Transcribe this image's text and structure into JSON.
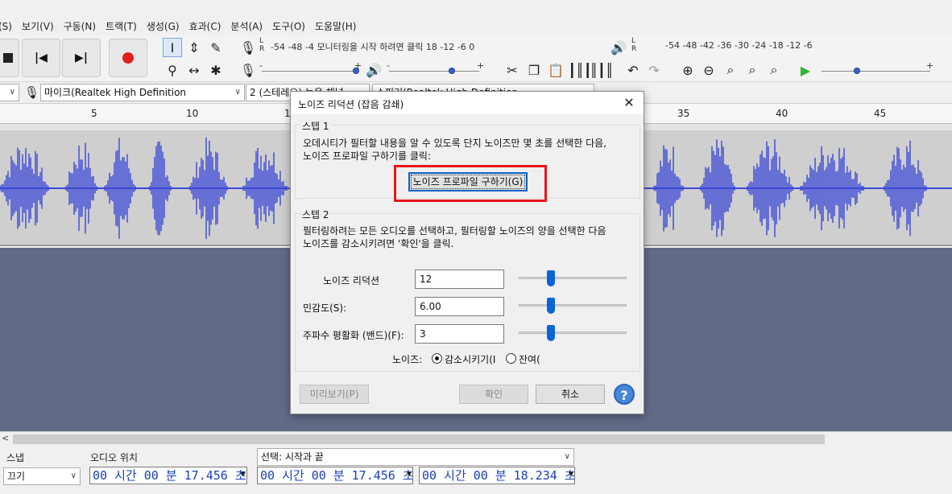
{
  "menu": [
    "(S)",
    "보기(V)",
    "구동(N)",
    "트랙(T)",
    "생성(G)",
    "효과(C)",
    "분석(A)",
    "도구(O)",
    "도움말(H)"
  ],
  "toolbar": {
    "rec_meter_text": "-54   -48   -4 모니터링을 시작 하려면 클릭 18   -12   -6   0",
    "play_meter_text": "-54   -48   -42   -36   -30   -24   -18   -12   -6",
    "meter_lr": [
      "L",
      "R"
    ],
    "slider_minus": "-",
    "slider_plus": "+"
  },
  "devices": {
    "mic_label": "마이크(Realtek High Definition",
    "channels": "2 (스테레오) 녹음 채널",
    "speaker": "스피커(Realtek High Definition"
  },
  "ruler": [
    "5",
    "10",
    "1",
    "35",
    "40",
    "45"
  ],
  "dialog": {
    "title": "노이즈 리덕션 (잡음 감쇄)",
    "step1_label": "스텝 1",
    "step1_text_line1": "오데시티가 필터할 내용을 알 수 있도록 단지 노이즈만 몇 초를 선택한 다음,",
    "step1_text_line2": "노이즈 프로파일 구하기를 클릭:",
    "profile_button": "노이즈 프로파일 구하기(G)",
    "step2_label": "스텝 2",
    "step2_text_line1": "필터링하려는 모든 오디오를 선택하고, 필터링할 노이즈의 양을 선택한 다음",
    "step2_text_line2": "노이즈를 감소시키려면 '확인'을 클릭.",
    "params": [
      {
        "label": "노이즈 리덕션",
        "value": "12",
        "level": 0.3
      },
      {
        "label": "민감도(S):",
        "value": "6.00",
        "level": 0.3
      },
      {
        "label": "주파수 평활화 (밴드)(F):",
        "value": "3",
        "level": 0.3
      }
    ],
    "noise_label": "노이즈:",
    "radio_reduce": "감소시키기(I",
    "radio_residue": "잔여(",
    "preview_button": "미리보기(P)",
    "ok_button": "확인",
    "cancel_button": "취소",
    "help_button": "?"
  },
  "selection_toolbar": {
    "snap_label": "스냅",
    "snap_value": "끄기",
    "audio_pos_label": "오디오 위치",
    "audio_pos_value": "00 시간 00 분 17.456 초",
    "selection_label": "선택: 시작과 끝",
    "sel_start": "00 시간 00 분 17.456 초",
    "sel_end": "00 시간 00 분 18.234 초"
  },
  "colors": {
    "waveform": "#3a48d6",
    "empty_area": "#626a87",
    "highlight": "#e8151b",
    "accent": "#0a64d6"
  }
}
